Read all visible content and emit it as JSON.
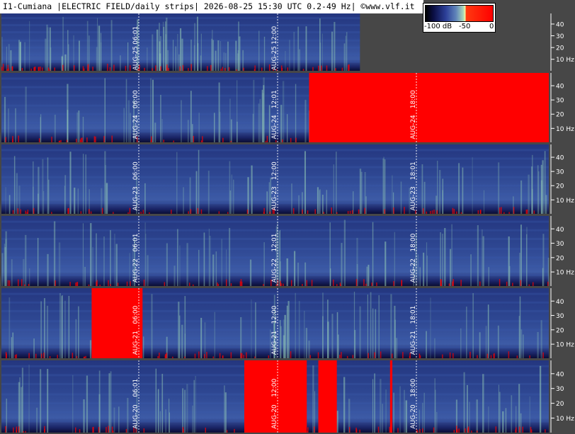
{
  "header": {
    "title": "I1-Cumiana |ELECTRIC FIELD/daily strips| 2026-08-25 15:30 UTC 0.2-49 Hz| ©www.vlf.it"
  },
  "legend": {
    "labels": [
      "-100 dB",
      "-50",
      "0"
    ],
    "range_db": [
      -100,
      0
    ]
  },
  "colors": {
    "background": "#474747",
    "spectrogram_low": "#14184f",
    "spectrogram_mid": "#3a5aa8",
    "spectrogram_high": "#9ad2b8",
    "saturation": "#ff0000"
  },
  "chart_data": {
    "type": "heatmap",
    "ylim": [
      0.2,
      49
    ],
    "y_unit": "Hz",
    "y_ticks": [
      "40",
      "30",
      "20",
      "10 Hz"
    ],
    "strips": [
      {
        "date_label": "AUG-25",
        "time_marks": [
          "06:01",
          "12:00"
        ],
        "data_end_hour": 15.5
      },
      {
        "date_label": "AUG-24",
        "time_marks": [
          "06:00",
          "12:01",
          "18:00"
        ],
        "data_end_hour": 24
      },
      {
        "date_label": "AUG-23",
        "time_marks": [
          "06:00",
          "12:00",
          "18:01"
        ],
        "data_end_hour": 24
      },
      {
        "date_label": "AUG-22",
        "time_marks": [
          "06:01",
          "12:01",
          "18:00"
        ],
        "data_end_hour": 24
      },
      {
        "date_label": "AUG-21",
        "time_marks": [
          "06:00",
          "12:00",
          "18:01"
        ],
        "data_end_hour": 24
      },
      {
        "date_label": "AUG-20",
        "time_marks": [
          "06:01",
          "12:00",
          "18:00"
        ],
        "data_end_hour": 24
      }
    ]
  }
}
